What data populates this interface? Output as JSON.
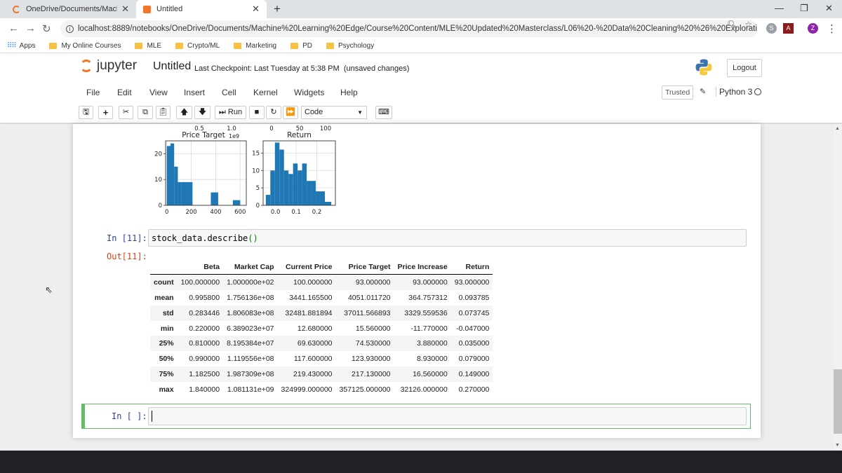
{
  "browser": {
    "tabs": [
      {
        "title": "OneDrive/Documents/Machine L"
      },
      {
        "title": "Untitled"
      }
    ],
    "url": "localhost:8889/notebooks/OneDrive/Documents/Machine%20Learning%20Edge/Course%20Content/MLE%20Updated%20Masterclass/L06%20-%20Data%20Cleaning%20%26%20Explorati...",
    "bookmarks": [
      "Apps",
      "My Online Courses",
      "MLE",
      "Crypto/ML",
      "Marketing",
      "PD",
      "Psychology"
    ],
    "profile_initial": "Z"
  },
  "jupyter": {
    "logo_text": "jupyter",
    "notebook_name": "Untitled",
    "checkpoint": "Last Checkpoint: Last Tuesday at 5:38 PM",
    "save_status": "(unsaved changes)",
    "logout_label": "Logout",
    "menu": [
      "File",
      "Edit",
      "View",
      "Insert",
      "Cell",
      "Kernel",
      "Widgets",
      "Help"
    ],
    "trusted_label": "Trusted",
    "kernel_name": "Python 3",
    "toolbar": {
      "run_label": "Run",
      "cell_type": "Code"
    }
  },
  "cells": {
    "describe": {
      "in_prompt": "In [11]:",
      "code_name": "stock_data.describe",
      "code_parens": "()",
      "out_prompt": "Out[11]:"
    },
    "empty": {
      "in_prompt": "In [ ]:"
    }
  },
  "describe_table": {
    "columns": [
      "",
      "Beta",
      "Market Cap",
      "Current Price",
      "Price Target",
      "Price Increase",
      "Return"
    ],
    "rows": [
      {
        "label": "count",
        "values": [
          "100.000000",
          "1.000000e+02",
          "100.000000",
          "93.000000",
          "93.000000",
          "93.000000"
        ]
      },
      {
        "label": "mean",
        "values": [
          "0.995800",
          "1.756136e+08",
          "3441.165500",
          "4051.011720",
          "364.757312",
          "0.093785"
        ]
      },
      {
        "label": "std",
        "values": [
          "0.283446",
          "1.806083e+08",
          "32481.881894",
          "37011.566893",
          "3329.559536",
          "0.073745"
        ]
      },
      {
        "label": "min",
        "values": [
          "0.220000",
          "6.389023e+07",
          "12.680000",
          "15.560000",
          "-11.770000",
          "-0.047000"
        ]
      },
      {
        "label": "25%",
        "values": [
          "0.810000",
          "8.195384e+07",
          "69.630000",
          "74.530000",
          "3.880000",
          "0.035000"
        ]
      },
      {
        "label": "50%",
        "values": [
          "0.990000",
          "1.119556e+08",
          "117.600000",
          "123.930000",
          "8.930000",
          "0.079000"
        ]
      },
      {
        "label": "75%",
        "values": [
          "1.182500",
          "1.987309e+08",
          "219.430000",
          "217.130000",
          "16.560000",
          "0.149000"
        ]
      },
      {
        "label": "max",
        "values": [
          "1.840000",
          "1.081131e+09",
          "324999.000000",
          "357125.000000",
          "32126.000000",
          "0.270000"
        ]
      }
    ]
  },
  "chart_data": [
    {
      "type": "bar",
      "xtick_labels_top": [
        "0.5",
        "1.0"
      ],
      "title": "Price Target",
      "title_exponent": "1e9",
      "xtick_labels": [
        "0",
        "200",
        "400",
        "600"
      ],
      "ytick_labels": [
        "0",
        "10",
        "20"
      ],
      "xlim": [
        -10,
        650
      ],
      "ylim": [
        0,
        25
      ],
      "bar_color": "#1f77b4",
      "bins": [
        {
          "x0": 0,
          "x1": 30,
          "count": 23
        },
        {
          "x0": 30,
          "x1": 60,
          "count": 24
        },
        {
          "x0": 60,
          "x1": 90,
          "count": 15
        },
        {
          "x0": 90,
          "x1": 120,
          "count": 9
        },
        {
          "x0": 120,
          "x1": 210,
          "count": 9
        },
        {
          "x0": 210,
          "x1": 360,
          "count": 0
        },
        {
          "x0": 360,
          "x1": 420,
          "count": 5
        },
        {
          "x0": 420,
          "x1": 540,
          "count": 0
        },
        {
          "x0": 540,
          "x1": 600,
          "count": 2
        }
      ]
    },
    {
      "type": "bar",
      "xtick_labels_top": [
        "0",
        "50",
        "100"
      ],
      "title": "Return",
      "xtick_labels": [
        "0.0",
        "0.1",
        "0.2"
      ],
      "ytick_labels": [
        "0",
        "5",
        "10",
        "15"
      ],
      "xlim": [
        -0.06,
        0.29
      ],
      "ylim": [
        0,
        18.5
      ],
      "bar_color": "#1f77b4",
      "bins": [
        {
          "x0": -0.047,
          "x1": -0.025,
          "count": 3
        },
        {
          "x0": -0.025,
          "x1": -0.003,
          "count": 10
        },
        {
          "x0": -0.003,
          "x1": 0.019,
          "count": 18
        },
        {
          "x0": 0.019,
          "x1": 0.041,
          "count": 16
        },
        {
          "x0": 0.041,
          "x1": 0.063,
          "count": 10
        },
        {
          "x0": 0.063,
          "x1": 0.085,
          "count": 9
        },
        {
          "x0": 0.085,
          "x1": 0.107,
          "count": 12
        },
        {
          "x0": 0.107,
          "x1": 0.129,
          "count": 10
        },
        {
          "x0": 0.129,
          "x1": 0.151,
          "count": 12
        },
        {
          "x0": 0.151,
          "x1": 0.173,
          "count": 7
        },
        {
          "x0": 0.173,
          "x1": 0.195,
          "count": 7
        },
        {
          "x0": 0.195,
          "x1": 0.217,
          "count": 4
        },
        {
          "x0": 0.217,
          "x1": 0.239,
          "count": 4
        },
        {
          "x0": 0.239,
          "x1": 0.261,
          "count": 1
        },
        {
          "x0": 0.261,
          "x1": 0.27,
          "count": 1
        }
      ]
    }
  ]
}
